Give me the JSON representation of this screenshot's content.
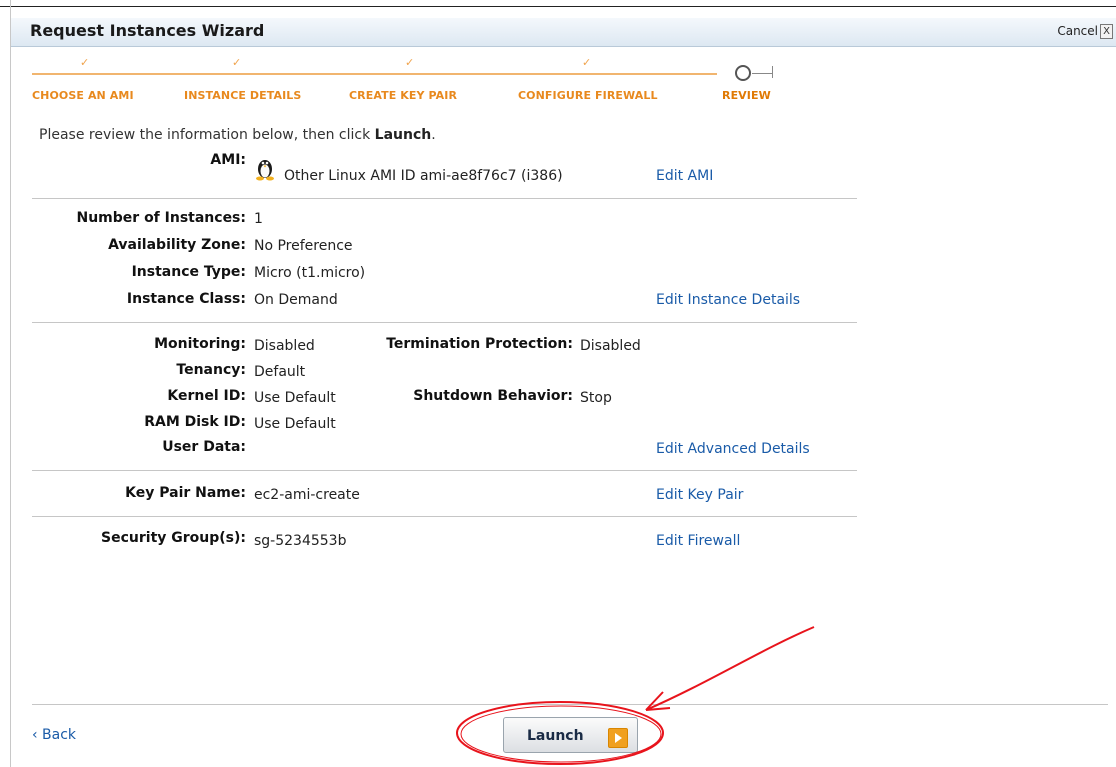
{
  "window": {
    "title": "Request Instances Wizard",
    "cancel_label": "Cancel",
    "close_glyph": "X"
  },
  "steps": [
    {
      "label": "CHOOSE AN AMI",
      "done": true
    },
    {
      "label": "INSTANCE DETAILS",
      "done": true
    },
    {
      "label": "CREATE KEY PAIR",
      "done": true
    },
    {
      "label": "CONFIGURE FIREWALL",
      "done": true
    },
    {
      "label": "REVIEW",
      "done": false,
      "active": true
    }
  ],
  "check_glyph": "✓",
  "intro": {
    "text": "Please review the information below, then click ",
    "bold": "Launch",
    "end": "."
  },
  "ami": {
    "label": "AMI:",
    "value": "Other Linux AMI ID ami-ae8f76c7 (i386)",
    "edit": "Edit AMI",
    "icon": "linux-penguin-icon"
  },
  "instance": {
    "rows": [
      {
        "label": "Number of Instances:",
        "value": "1"
      },
      {
        "label": "Availability Zone:",
        "value": "No Preference"
      },
      {
        "label": "Instance Type:",
        "value": "Micro (t1.micro)"
      },
      {
        "label": "Instance Class:",
        "value": "On Demand"
      }
    ],
    "edit": "Edit Instance Details"
  },
  "advanced": {
    "monitoring": {
      "label": "Monitoring:",
      "value": "Disabled"
    },
    "termination": {
      "label": "Termination Protection:",
      "value": "Disabled"
    },
    "tenancy": {
      "label": "Tenancy:",
      "value": "Default"
    },
    "kernel": {
      "label": "Kernel ID:",
      "value": "Use Default"
    },
    "shutdown": {
      "label": "Shutdown Behavior:",
      "value": "Stop"
    },
    "ramdisk": {
      "label": "RAM Disk ID:",
      "value": "Use Default"
    },
    "userdata": {
      "label": "User Data:",
      "value": ""
    },
    "edit": "Edit Advanced Details"
  },
  "keypair": {
    "label": "Key Pair Name:",
    "value": "ec2-ami-create",
    "edit": "Edit Key Pair"
  },
  "security": {
    "label": "Security Group(s):",
    "value": "sg-5234553b",
    "edit": "Edit Firewall"
  },
  "footer": {
    "back": "‹ Back",
    "launch": "Launch"
  },
  "colors": {
    "accent_orange": "#e8891e",
    "link_blue": "#1a5ba8",
    "annotation_red": "#e8141c"
  }
}
